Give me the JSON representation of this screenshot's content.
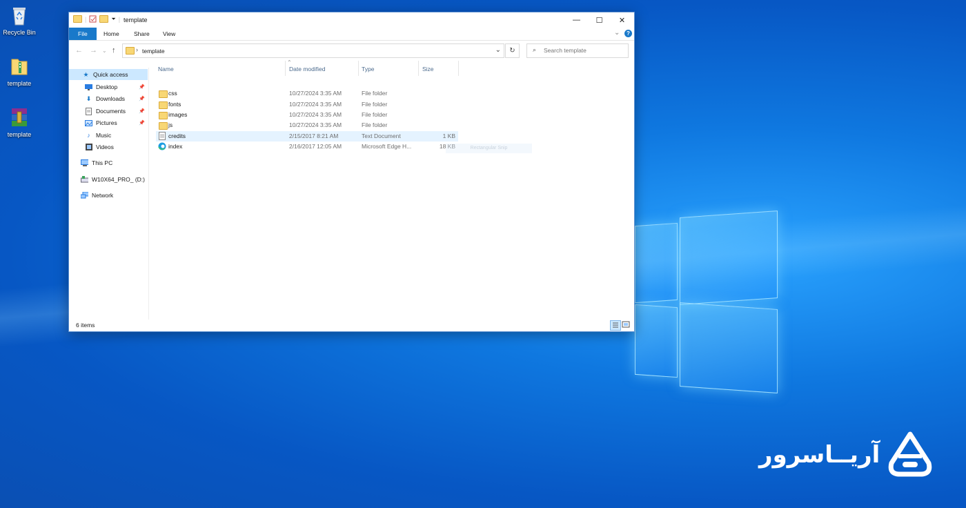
{
  "desktop": {
    "icons": [
      {
        "label": "Recycle Bin",
        "icon": "recycle-bin-icon"
      },
      {
        "label": "template",
        "icon": "folder-zip-icon"
      },
      {
        "label": "template",
        "icon": "winrar-archive-icon"
      }
    ],
    "brand_text": "آریــاسرور"
  },
  "window": {
    "title": "template",
    "controls": {
      "minimize": "—",
      "maximize": "☐",
      "close": "✕"
    },
    "ribbon": {
      "tabs": [
        "File",
        "Home",
        "Share",
        "View"
      ],
      "expand": "⌄",
      "help": "?"
    },
    "address": {
      "path": "template",
      "sep": "›",
      "dropdown": "⌄",
      "refresh": "↻"
    },
    "search": {
      "placeholder": "Search template"
    },
    "nav_arrows": {
      "back": "←",
      "forward": "→",
      "recent": "⌄",
      "up": "↑"
    },
    "navigation": [
      {
        "label": "Quick access",
        "icon": "star-icon",
        "pinned": false
      },
      {
        "label": "Desktop",
        "icon": "desktop-icon",
        "pinned": true
      },
      {
        "label": "Downloads",
        "icon": "download-icon",
        "pinned": true
      },
      {
        "label": "Documents",
        "icon": "documents-icon",
        "pinned": true
      },
      {
        "label": "Pictures",
        "icon": "pictures-icon",
        "pinned": true
      },
      {
        "label": "Music",
        "icon": "music-icon",
        "pinned": false
      },
      {
        "label": "Videos",
        "icon": "videos-icon",
        "pinned": false
      },
      {
        "label": "This PC",
        "icon": "computer-icon",
        "pinned": false
      },
      {
        "label": "W10X64_PRO_ (D:)",
        "icon": "drive-icon",
        "pinned": false
      },
      {
        "label": "Network",
        "icon": "network-icon",
        "pinned": false
      }
    ],
    "columns": [
      "Name",
      "Date modified",
      "Type",
      "Size"
    ],
    "files": [
      {
        "name": "css",
        "date": "10/27/2024 3:35 AM",
        "type": "File folder",
        "size": "",
        "icon": "folder-icon"
      },
      {
        "name": "fonts",
        "date": "10/27/2024 3:35 AM",
        "type": "File folder",
        "size": "",
        "icon": "folder-icon"
      },
      {
        "name": "images",
        "date": "10/27/2024 3:35 AM",
        "type": "File folder",
        "size": "",
        "icon": "folder-icon"
      },
      {
        "name": "js",
        "date": "10/27/2024 3:35 AM",
        "type": "File folder",
        "size": "",
        "icon": "folder-icon"
      },
      {
        "name": "credits",
        "date": "2/15/2017 8:21 AM",
        "type": "Text Document",
        "size": "1 KB",
        "icon": "text-document-icon"
      },
      {
        "name": "index",
        "date": "2/16/2017 12:05 AM",
        "type": "Microsoft Edge H...",
        "size": "18 KB",
        "icon": "edge-icon"
      }
    ],
    "tooltip": "Rectangular Snip",
    "status": "6 items"
  }
}
